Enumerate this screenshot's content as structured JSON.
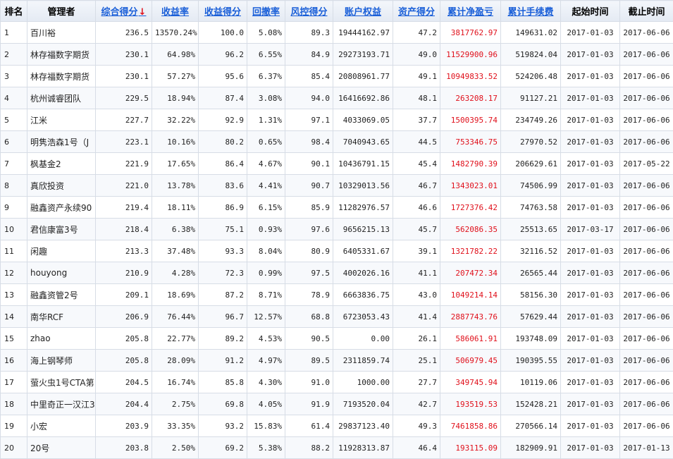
{
  "headers": {
    "rank": "排名",
    "manager": "管理者",
    "composite_score": "综合得分",
    "sort_arrow": "↓",
    "return_rate": "收益率",
    "return_score": "收益得分",
    "drawdown": "回撤率",
    "risk_score": "风控得分",
    "equity": "账户权益",
    "asset_score": "资产得分",
    "net_pnl": "累计净盈亏",
    "fees": "累计手续费",
    "start": "起始时间",
    "end": "截止时间"
  },
  "rows": [
    {
      "rank": "1",
      "manager": "百川裕",
      "score": "236.5",
      "ret": "13570.24%",
      "retScore": "100.0",
      "dd": "5.08%",
      "risk": "89.3",
      "equity": "19444162.97",
      "asset": "47.2",
      "pnl": "3817762.97",
      "fee": "149631.02",
      "start": "2017-01-03",
      "end": "2017-06-06"
    },
    {
      "rank": "2",
      "manager": "林存福数字期货",
      "score": "230.1",
      "ret": "64.98%",
      "retScore": "96.2",
      "dd": "6.55%",
      "risk": "84.9",
      "equity": "29273193.71",
      "asset": "49.0",
      "pnl": "11529900.96",
      "fee": "519824.04",
      "start": "2017-01-03",
      "end": "2017-06-06"
    },
    {
      "rank": "3",
      "manager": "林存福数字期货",
      "score": "230.1",
      "ret": "57.27%",
      "retScore": "95.6",
      "dd": "6.37%",
      "risk": "85.4",
      "equity": "20808961.77",
      "asset": "49.1",
      "pnl": "10949833.52",
      "fee": "524206.48",
      "start": "2017-01-03",
      "end": "2017-06-06"
    },
    {
      "rank": "4",
      "manager": "杭州诚睿团队",
      "score": "229.5",
      "ret": "18.94%",
      "retScore": "87.4",
      "dd": "3.08%",
      "risk": "94.0",
      "equity": "16416692.86",
      "asset": "48.1",
      "pnl": "263208.17",
      "fee": "91127.21",
      "start": "2017-01-03",
      "end": "2017-06-06"
    },
    {
      "rank": "5",
      "manager": "江米",
      "score": "227.7",
      "ret": "32.22%",
      "retScore": "92.9",
      "dd": "1.31%",
      "risk": "97.1",
      "equity": "4033069.05",
      "asset": "37.7",
      "pnl": "1500395.74",
      "fee": "234749.26",
      "start": "2017-01-03",
      "end": "2017-06-06"
    },
    {
      "rank": "6",
      "manager": "明隽浩森1号（J",
      "score": "223.1",
      "ret": "10.16%",
      "retScore": "80.2",
      "dd": "0.65%",
      "risk": "98.4",
      "equity": "7040943.65",
      "asset": "44.5",
      "pnl": "753346.75",
      "fee": "27970.52",
      "start": "2017-01-03",
      "end": "2017-06-06"
    },
    {
      "rank": "7",
      "manager": "枫基金2",
      "score": "221.9",
      "ret": "17.65%",
      "retScore": "86.4",
      "dd": "4.67%",
      "risk": "90.1",
      "equity": "10436791.15",
      "asset": "45.4",
      "pnl": "1482790.39",
      "fee": "206629.61",
      "start": "2017-01-03",
      "end": "2017-05-22"
    },
    {
      "rank": "8",
      "manager": "真欣投资",
      "score": "221.0",
      "ret": "13.78%",
      "retScore": "83.6",
      "dd": "4.41%",
      "risk": "90.7",
      "equity": "10329013.56",
      "asset": "46.7",
      "pnl": "1343023.01",
      "fee": "74506.99",
      "start": "2017-01-03",
      "end": "2017-06-06"
    },
    {
      "rank": "9",
      "manager": "融鑫资产永续90",
      "score": "219.4",
      "ret": "18.11%",
      "retScore": "86.9",
      "dd": "6.15%",
      "risk": "85.9",
      "equity": "11282976.57",
      "asset": "46.6",
      "pnl": "1727376.42",
      "fee": "74763.58",
      "start": "2017-01-03",
      "end": "2017-06-06"
    },
    {
      "rank": "10",
      "manager": "君信康富3号",
      "score": "218.4",
      "ret": "6.38%",
      "retScore": "75.1",
      "dd": "0.93%",
      "risk": "97.6",
      "equity": "9656215.13",
      "asset": "45.7",
      "pnl": "562086.35",
      "fee": "25513.65",
      "start": "2017-03-17",
      "end": "2017-06-06"
    },
    {
      "rank": "11",
      "manager": "闲趣",
      "score": "213.3",
      "ret": "37.48%",
      "retScore": "93.3",
      "dd": "8.04%",
      "risk": "80.9",
      "equity": "6405331.67",
      "asset": "39.1",
      "pnl": "1321782.22",
      "fee": "32116.52",
      "start": "2017-01-03",
      "end": "2017-06-06"
    },
    {
      "rank": "12",
      "manager": "houyong",
      "score": "210.9",
      "ret": "4.28%",
      "retScore": "72.3",
      "dd": "0.99%",
      "risk": "97.5",
      "equity": "4002026.16",
      "asset": "41.1",
      "pnl": "207472.34",
      "fee": "26565.44",
      "start": "2017-01-03",
      "end": "2017-06-06"
    },
    {
      "rank": "13",
      "manager": "融鑫资管2号",
      "score": "209.1",
      "ret": "18.69%",
      "retScore": "87.2",
      "dd": "8.71%",
      "risk": "78.9",
      "equity": "6663836.75",
      "asset": "43.0",
      "pnl": "1049214.14",
      "fee": "58156.30",
      "start": "2017-01-03",
      "end": "2017-06-06"
    },
    {
      "rank": "14",
      "manager": "南华RCF",
      "score": "206.9",
      "ret": "76.44%",
      "retScore": "96.7",
      "dd": "12.57%",
      "risk": "68.8",
      "equity": "6723053.43",
      "asset": "41.4",
      "pnl": "2887743.76",
      "fee": "57629.44",
      "start": "2017-01-03",
      "end": "2017-06-06"
    },
    {
      "rank": "15",
      "manager": "zhao",
      "score": "205.8",
      "ret": "22.77%",
      "retScore": "89.2",
      "dd": "4.53%",
      "risk": "90.5",
      "equity": "0.00",
      "asset": "26.1",
      "pnl": "586061.91",
      "fee": "193748.09",
      "start": "2017-01-03",
      "end": "2017-06-06"
    },
    {
      "rank": "16",
      "manager": "海上钢琴师",
      "score": "205.8",
      "ret": "28.09%",
      "retScore": "91.2",
      "dd": "4.97%",
      "risk": "89.5",
      "equity": "2311859.74",
      "asset": "25.1",
      "pnl": "506979.45",
      "fee": "190395.55",
      "start": "2017-01-03",
      "end": "2017-06-06"
    },
    {
      "rank": "17",
      "manager": "萤火虫1号CTA第",
      "score": "204.5",
      "ret": "16.74%",
      "retScore": "85.8",
      "dd": "4.30%",
      "risk": "91.0",
      "equity": "1000.00",
      "asset": "27.7",
      "pnl": "349745.94",
      "fee": "10119.06",
      "start": "2017-01-03",
      "end": "2017-06-06"
    },
    {
      "rank": "18",
      "manager": "中里奇正一汉江3",
      "score": "204.4",
      "ret": "2.75%",
      "retScore": "69.8",
      "dd": "4.05%",
      "risk": "91.9",
      "equity": "7193520.04",
      "asset": "42.7",
      "pnl": "193519.53",
      "fee": "152428.21",
      "start": "2017-01-03",
      "end": "2017-06-06"
    },
    {
      "rank": "19",
      "manager": "小宏",
      "score": "203.9",
      "ret": "33.35%",
      "retScore": "93.2",
      "dd": "15.83%",
      "risk": "61.4",
      "equity": "29837123.40",
      "asset": "49.3",
      "pnl": "7461858.86",
      "fee": "270566.14",
      "start": "2017-01-03",
      "end": "2017-06-06"
    },
    {
      "rank": "20",
      "manager": "20号",
      "score": "203.8",
      "ret": "2.50%",
      "retScore": "69.2",
      "dd": "5.38%",
      "risk": "88.2",
      "equity": "11928313.87",
      "asset": "46.4",
      "pnl": "193115.09",
      "fee": "182909.91",
      "start": "2017-01-03",
      "end": "2017-01-13"
    }
  ]
}
